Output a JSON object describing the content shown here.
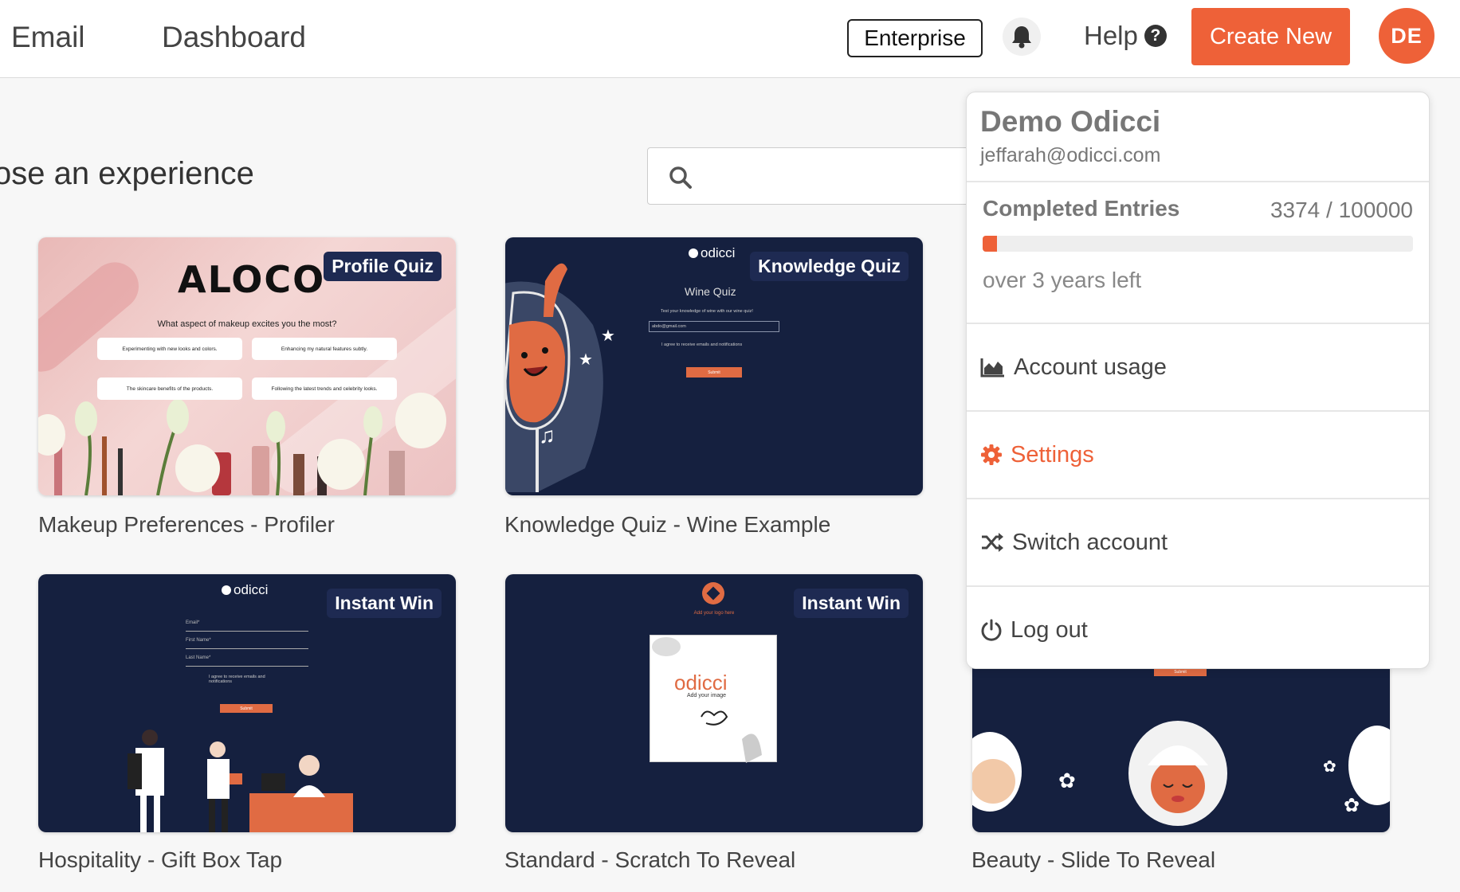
{
  "nav": {
    "email": "Email",
    "dashboard": "Dashboard"
  },
  "header": {
    "enterprise": "Enterprise",
    "help": "Help",
    "create_new": "Create New",
    "avatar_initials": "DE"
  },
  "main": {
    "heading": "ose an experience",
    "search_placeholder": ""
  },
  "cards": [
    {
      "title": "Makeup Preferences - Profiler",
      "badge": "Profile Quiz"
    },
    {
      "title": "Knowledge Quiz - Wine Example",
      "badge": "Knowledge Quiz"
    },
    {
      "title": "Hospitality - Gift Box Tap",
      "badge": "Instant Win"
    },
    {
      "title": "Standard - Scratch To Reveal",
      "badge": "Instant Win"
    },
    {
      "title": "Beauty - Slide To Reveal",
      "badge": ""
    }
  ],
  "previews": {
    "makeup": {
      "brand": "ALOCO",
      "question": "What aspect of makeup excites you the most?",
      "options": [
        "Experimenting with new looks and colors.",
        "Enhancing my natural features subtly.",
        "The skincare benefits of the products.",
        "Following the latest trends and celebrity looks."
      ]
    },
    "wine": {
      "logo": "odicci",
      "title": "Wine Quiz",
      "subtitle": "Test your knowledge of wine with our wine quiz!",
      "email_value": "abdo@gmail.com",
      "consent": "I agree to receive emails and notifications",
      "submit": "Submit"
    },
    "hospitality": {
      "logo": "odicci",
      "fields": [
        "Email*",
        "First Name*",
        "Last Name*"
      ],
      "consent": "I agree to receive emails and notifications",
      "submit": "Submit"
    },
    "scratch": {
      "logo_text": "Add your logo here",
      "brand": "odicci",
      "image_text": "Add your image"
    },
    "beauty": {
      "submit": "Submit"
    }
  },
  "dropdown": {
    "name": "Demo Odicci",
    "email": "jeffarah@odicci.com",
    "entries_label": "Completed Entries",
    "entries_value": "3374 / 100000",
    "entries_fraction": 0.03374,
    "time_left": "over 3 years left",
    "items": [
      {
        "label": "Account usage",
        "icon": "area-chart-icon"
      },
      {
        "label": "Settings",
        "icon": "gear-icon"
      },
      {
        "label": "Switch account",
        "icon": "shuffle-icon"
      },
      {
        "label": "Log out",
        "icon": "power-icon"
      }
    ]
  },
  "colors": {
    "accent": "#ee6138",
    "navy": "#15203f",
    "badge": "#1e2a52"
  }
}
